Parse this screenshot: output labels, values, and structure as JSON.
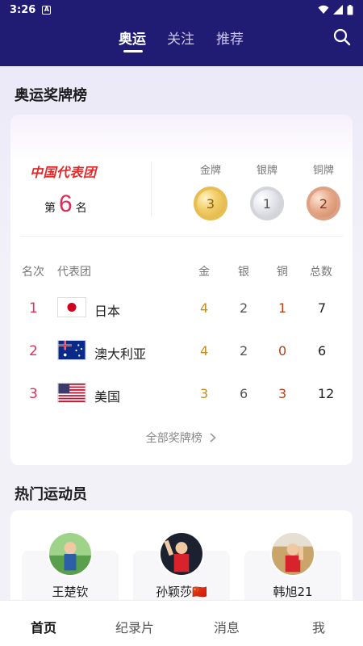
{
  "status": {
    "time": "3:26",
    "notif_icon": "A"
  },
  "tabs": [
    {
      "label": "奥运",
      "active": true
    },
    {
      "label": "关注",
      "active": false
    },
    {
      "label": "推荐",
      "active": false
    }
  ],
  "medal_section": {
    "title": "奥运奖牌榜",
    "team_name": "中国代表团",
    "rank_prefix": "第",
    "rank_value": "6",
    "rank_suffix": "名",
    "medal_labels": {
      "gold": "金牌",
      "silver": "银牌",
      "bronze": "铜牌"
    },
    "medal_counts": {
      "gold": "3",
      "silver": "1",
      "bronze": "2"
    },
    "table_headers": {
      "rank": "名次",
      "team": "代表团",
      "gold": "金",
      "silver": "银",
      "bronze": "铜",
      "total": "总数"
    },
    "rows": [
      {
        "rank": "1",
        "country": "日本",
        "gold": "4",
        "silver": "2",
        "bronze": "1",
        "total": "7"
      },
      {
        "rank": "2",
        "country": "澳大利亚",
        "gold": "4",
        "silver": "2",
        "bronze": "0",
        "total": "6"
      },
      {
        "rank": "3",
        "country": "美国",
        "gold": "3",
        "silver": "6",
        "bronze": "3",
        "total": "12"
      }
    ],
    "more_link": "全部奖牌榜"
  },
  "athletes_section": {
    "title": "热门运动员",
    "athletes": [
      {
        "name": "王楚钦"
      },
      {
        "name": "孙颖莎🇨🇳"
      },
      {
        "name": "韩旭21"
      }
    ]
  },
  "bottom_nav": [
    {
      "label": "首页",
      "active": true
    },
    {
      "label": "纪录片",
      "active": false
    },
    {
      "label": "消息",
      "active": false
    },
    {
      "label": "我",
      "active": false
    }
  ],
  "colors": {
    "header_bg": "#201b73",
    "rank_accent": "#e0305a",
    "team_red": "#e02a2a"
  }
}
